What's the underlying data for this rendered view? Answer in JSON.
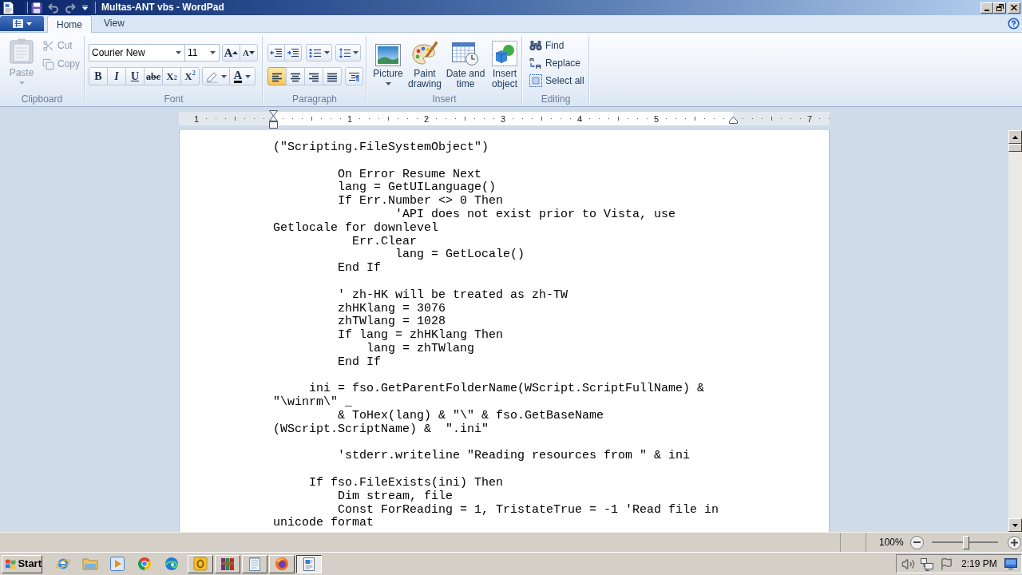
{
  "window": {
    "title": "Multas-ANT vbs - WordPad"
  },
  "quick_access": [
    {
      "kind": "save",
      "disabled": false
    },
    {
      "kind": "undo",
      "disabled": true
    },
    {
      "kind": "redo",
      "disabled": true
    }
  ],
  "ribbon_tabs": [
    {
      "label": "Home",
      "selected": true
    },
    {
      "label": "View",
      "selected": false
    }
  ],
  "clipboard": {
    "label": "Clipboard",
    "items": [
      {
        "kind": "paste",
        "label": "Paste",
        "disabled": true
      },
      {
        "kind": "cut",
        "label": "Cut",
        "disabled": true
      },
      {
        "kind": "copy",
        "label": "Copy",
        "disabled": true
      }
    ]
  },
  "font": {
    "label": "Font",
    "font_name": "Courier New",
    "font_size": "11",
    "grow": "A",
    "shrink": "A",
    "styles": [
      {
        "kind": "bold",
        "label": "B"
      },
      {
        "kind": "italic",
        "label": "I"
      },
      {
        "kind": "underline",
        "label": "U"
      },
      {
        "kind": "strikethrough",
        "label": "abc"
      },
      {
        "kind": "subscript",
        "label": "X$_{2}$"
      },
      {
        "kind": "superscript",
        "label": "X$^{2}$"
      }
    ],
    "font_color": "A"
  },
  "paragraph": {
    "label": "Paragraph",
    "alignment": [
      {
        "kind": "left",
        "selected": true
      },
      {
        "kind": "center",
        "selected": false
      },
      {
        "kind": "right",
        "selected": false
      },
      {
        "kind": "justify",
        "selected": false
      }
    ]
  },
  "insert": {
    "label": "Insert",
    "items": [
      {
        "kind": "picture",
        "label": "Picture",
        "dropdown": true
      },
      {
        "kind": "paint",
        "label": "Paint drawing",
        "dropdown": false
      },
      {
        "kind": "datetime",
        "label": "Date and time",
        "dropdown": false
      },
      {
        "kind": "object",
        "label": "Insert object",
        "dropdown": false
      }
    ]
  },
  "editing": {
    "label": "Editing",
    "items": [
      {
        "kind": "find",
        "label": "Find"
      },
      {
        "kind": "replace",
        "label": "Replace"
      },
      {
        "kind": "select_all",
        "label": "Select all"
      }
    ]
  },
  "ruler": {
    "marks": [
      {
        "kind": "number",
        "label": "1"
      },
      {
        "kind": "left_indent"
      },
      {
        "kind": "number",
        "label": "1"
      },
      {
        "kind": "number",
        "label": "2"
      },
      {
        "kind": "number",
        "label": "3"
      },
      {
        "kind": "number",
        "label": "4"
      },
      {
        "kind": "number",
        "label": "5"
      },
      {
        "kind": "right_indent"
      },
      {
        "kind": "number",
        "label": "7"
      }
    ]
  },
  "document": {
    "blocks": [
      [
        "(\"Scripting.FileSystemObject\")"
      ],
      [
        "         On Error Resume Next",
        "         lang = GetUILanguage()",
        "         If Err.Number <> 0 Then",
        "                 'API does not exist prior to Vista, use",
        "Getlocale for downlevel",
        "           Err.Clear",
        "                 lang = GetLocale()",
        "         End If"
      ],
      [
        "         ' zh-HK will be treated as zh-TW",
        "         zhHKlang = 3076",
        "         zhTWlang = 1028",
        "         If lang = zhHKlang Then",
        "             lang = zhTWlang",
        "         End If"
      ],
      [
        "     ini = fso.GetParentFolderName(WScript.ScriptFullName) &",
        "\"\\winrm\\\" _",
        "         & ToHex(lang) & \"\\\" & fso.GetBaseName",
        "(WScript.ScriptName) &  \".ini\""
      ],
      [
        "         'stderr.writeline \"Reading resources from \" & ini"
      ],
      [
        "     If fso.FileExists(ini) Then",
        "         Dim stream, file",
        "         Const ForReading = 1, TristateTrue = -1 'Read file in",
        "unicode format"
      ]
    ]
  },
  "status_bar": {
    "zoom": {
      "reading": "100%",
      "level": 0.52
    }
  },
  "taskbar": {
    "start": "Start",
    "quick_launch": [
      {
        "kind": "ie"
      },
      {
        "kind": "folder"
      },
      {
        "kind": "media"
      },
      {
        "kind": "chrome"
      },
      {
        "kind": "edge"
      }
    ],
    "tasks": [
      {
        "kind": "outlook",
        "selected": false
      },
      {
        "kind": "winrar",
        "selected": false
      },
      {
        "kind": "notepad",
        "selected": false
      },
      {
        "kind": "firefox",
        "selected": false
      },
      {
        "kind": "wordpad",
        "selected": true
      }
    ],
    "tray": {
      "icons": [
        {
          "kind": "speaker"
        },
        {
          "kind": "network"
        },
        {
          "kind": "flag"
        }
      ],
      "time": "2:19 PM"
    }
  }
}
